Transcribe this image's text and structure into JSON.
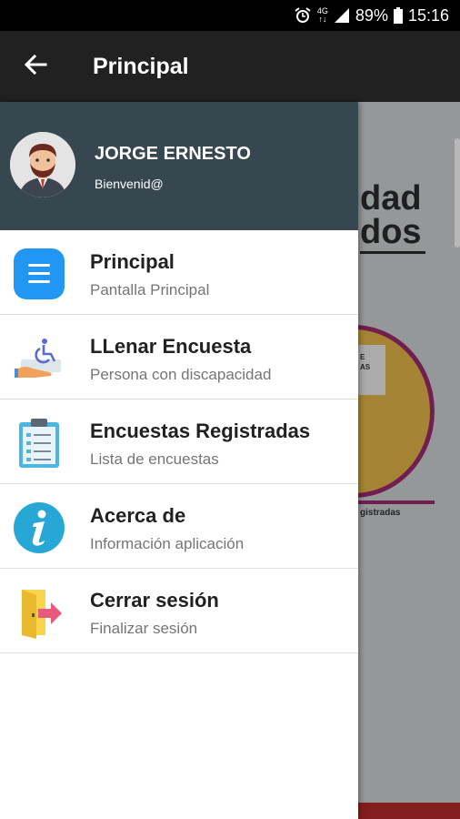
{
  "status_bar": {
    "network_top": "4G",
    "network_bottom": "↑↓",
    "battery": "89%",
    "time": "15:16"
  },
  "toolbar": {
    "title": "Principal"
  },
  "background": {
    "text_line1": "dad",
    "text_line2": "dos",
    "card_text": "E\nAS",
    "label": "gistradas"
  },
  "drawer": {
    "user_name": "JORGE ERNESTO",
    "greeting": "Bienvenid@",
    "items": [
      {
        "title": "Principal",
        "subtitle": "Pantalla Principal",
        "icon": "list-icon"
      },
      {
        "title": "LLenar Encuesta",
        "subtitle": "Persona con discapacidad",
        "icon": "accessibility-hand-icon"
      },
      {
        "title": "Encuestas Registradas",
        "subtitle": "Lista de encuestas",
        "icon": "clipboard-icon"
      },
      {
        "title": "Acerca de",
        "subtitle": "Información aplicación",
        "icon": "info-icon"
      },
      {
        "title": "Cerrar sesión",
        "subtitle": "Finalizar sesión",
        "icon": "exit-door-icon"
      }
    ]
  },
  "colors": {
    "toolbar": "#212121",
    "drawer_header": "#37474f",
    "primary_blue": "#2196f3",
    "info_teal": "#26a7d6"
  }
}
